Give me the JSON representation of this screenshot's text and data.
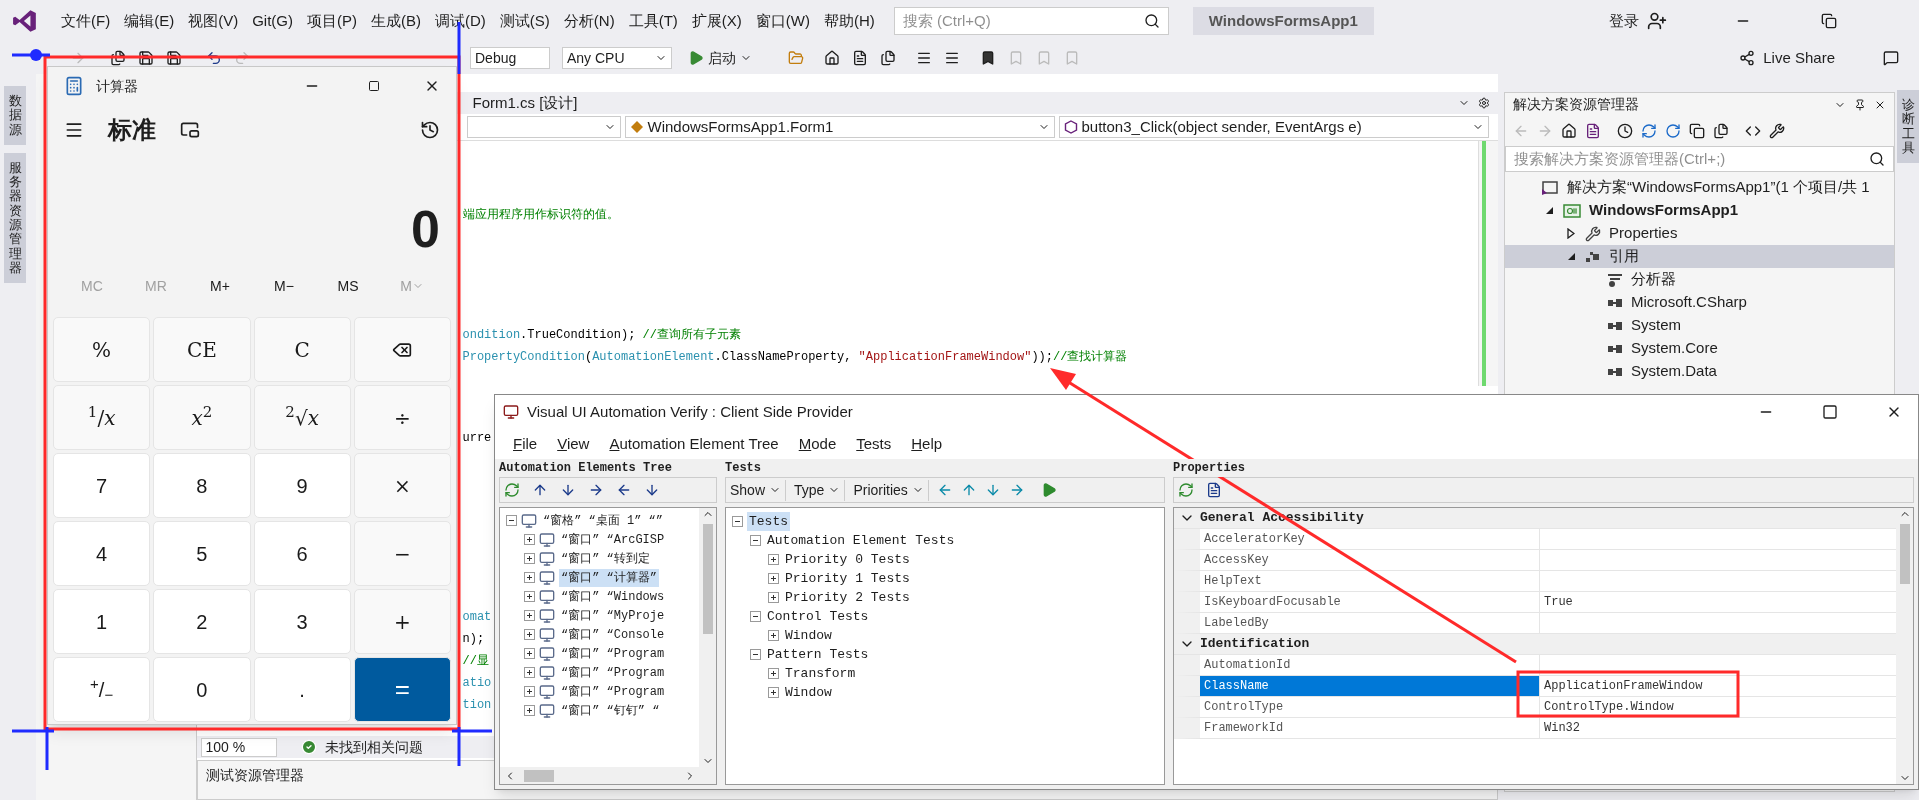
{
  "vs": {
    "menu": [
      "文件(F)",
      "编辑(E)",
      "视图(V)",
      "Git(G)",
      "项目(P)",
      "生成(B)",
      "调试(D)",
      "测试(S)",
      "分析(N)",
      "工具(T)",
      "扩展(X)",
      "窗口(W)",
      "帮助(H)"
    ],
    "search": {
      "placeholder": "搜索 (Ctrl+Q)"
    },
    "solution_name": "WindowsFormsApp1",
    "login": "登录",
    "toolbar": {
      "config": "Debug",
      "platform": "Any CPU",
      "start": "启动",
      "live_share": "Live Share"
    },
    "left_tabs": [
      "数据源",
      "服务器资源管理器"
    ],
    "right_tabs": [
      "诊断工具"
    ],
    "editor": {
      "tab": "Form1.cs [设计]",
      "nav": [
        "WindowsFormsApp1.Form1",
        "button3_Click(object sender, EventArgs e)"
      ],
      "blocks": [
        {
          "lines": [
            [
              {
                "kind": "comment",
                "text": "端应用程序用作标识符的值。"
              }
            ]
          ]
        },
        {
          "lines": [
            [
              {
                "kind": "type",
                "text": "ondition"
              },
              {
                "kind": "plain",
                "text": ".TrueCondition); "
              },
              {
                "kind": "comment",
                "text": "//查询所有子元素"
              }
            ],
            [
              {
                "kind": "type",
                "text": "PropertyCondition"
              },
              {
                "kind": "plain",
                "text": "("
              },
              {
                "kind": "type",
                "text": "AutomationElement"
              },
              {
                "kind": "plain",
                "text": ".ClassNameProperty, "
              },
              {
                "kind": "string",
                "text": "\"ApplicationFrameWindow\""
              },
              {
                "kind": "plain",
                "text": "));"
              },
              {
                "kind": "comment",
                "text": "//查找计算器"
              }
            ]
          ]
        },
        {
          "lines": [
            [
              {
                "kind": "plain",
                "text": "urre"
              }
            ]
          ]
        },
        {
          "lines": [
            [
              {
                "kind": "type",
                "text": "omat"
              }
            ],
            [
              {
                "kind": "plain",
                "text": "n);"
              }
            ],
            [
              {
                "kind": "comment",
                "text": "//显"
              }
            ],
            [
              {
                "kind": "type",
                "text": "atio"
              }
            ],
            [
              {
                "kind": "type",
                "text": "tion"
              }
            ]
          ]
        }
      ]
    },
    "status": {
      "zoom": "100 %",
      "issues": "未找到相关问题"
    },
    "bottom_panel": {
      "title": "测试资源管理器"
    }
  },
  "solution_explorer": {
    "title": "解决方案资源管理器",
    "search": {
      "placeholder": "搜索解决方案资源管理器(Ctrl+;)"
    },
    "tree": [
      {
        "kind": "solution",
        "label": "解决方案“WindowsFormsApp1”(1 个项目/共 1",
        "selected": false,
        "children": [
          {
            "kind": "csproject",
            "label": "WindowsFormsApp1",
            "expanded": true,
            "selected": false,
            "children": [
              {
                "kind": "properties",
                "label": "Properties",
                "expanded": false,
                "selected": false
              },
              {
                "kind": "references",
                "label": "引用",
                "expanded": true,
                "selected": true,
                "children": [
                  {
                    "kind": "analyzer",
                    "label": "分析器",
                    "selected": false
                  },
                  {
                    "kind": "assembly",
                    "label": "Microsoft.CSharp",
                    "selected": false
                  },
                  {
                    "kind": "assembly",
                    "label": "System",
                    "selected": false
                  },
                  {
                    "kind": "assembly",
                    "label": "System.Core",
                    "selected": false
                  },
                  {
                    "kind": "assembly",
                    "label": "System.Data",
                    "selected": false
                  }
                ]
              }
            ]
          }
        ]
      }
    ]
  },
  "calculator": {
    "title": "计算器",
    "mode": "标准",
    "display": "0",
    "memory": [
      {
        "label": "MC",
        "kind": "button",
        "disabled": true
      },
      {
        "label": "MR",
        "kind": "button",
        "disabled": true
      },
      {
        "label": "M+",
        "kind": "button",
        "disabled": false
      },
      {
        "label": "M−",
        "kind": "button",
        "disabled": false
      },
      {
        "label": "MS",
        "kind": "button",
        "disabled": false
      },
      {
        "label": "M",
        "kind": "menu",
        "disabled": true
      }
    ],
    "keys": [
      {
        "kind": "fn",
        "label": "%"
      },
      {
        "kind": "fn",
        "label": "CE"
      },
      {
        "kind": "fn",
        "label": "C"
      },
      {
        "kind": "backspace"
      },
      {
        "kind": "fn",
        "label": "$^{1}$/*x*"
      },
      {
        "kind": "fn",
        "label": "*x*$^{2}$"
      },
      {
        "kind": "fn",
        "label": "$^{2}$√*x*"
      },
      {
        "kind": "fn",
        "label": "÷"
      },
      {
        "kind": "digit",
        "label": "7"
      },
      {
        "kind": "digit",
        "label": "8"
      },
      {
        "kind": "digit",
        "label": "9"
      },
      {
        "kind": "fn",
        "label": "×"
      },
      {
        "kind": "digit",
        "label": "4"
      },
      {
        "kind": "digit",
        "label": "5"
      },
      {
        "kind": "digit",
        "label": "6"
      },
      {
        "kind": "fn",
        "label": "−"
      },
      {
        "kind": "digit",
        "label": "1"
      },
      {
        "kind": "digit",
        "label": "2"
      },
      {
        "kind": "digit",
        "label": "3"
      },
      {
        "kind": "fn",
        "label": "+"
      },
      {
        "kind": "digit",
        "label": "$^{+}$/$_{−}$"
      },
      {
        "kind": "digit",
        "label": "0"
      },
      {
        "kind": "digit",
        "label": "."
      },
      {
        "kind": "equals",
        "label": "="
      }
    ]
  },
  "uia": {
    "title": "Visual UI Automation Verify : Client Side Provider",
    "menu": [
      "File",
      "View",
      "Automation Element Tree",
      "Mode",
      "Tests",
      "Help"
    ],
    "tree_panel": {
      "title": "Automation Elements Tree",
      "tree": [
        {
          "label": "“窗格” “桌面 1” “”",
          "expanded": true,
          "selected": false,
          "children": [
            {
              "label": "“窗口” “ArcGISP",
              "expanded": false,
              "selected": false
            },
            {
              "label": "“窗口” “转到定",
              "expanded": false,
              "selected": false
            },
            {
              "label": "“窗口” “计算器”",
              "expanded": false,
              "selected": true
            },
            {
              "label": "“窗口” “Windows",
              "expanded": false,
              "selected": false
            },
            {
              "label": "“窗口” “MyProje",
              "expanded": false,
              "selected": false
            },
            {
              "label": "“窗口” “Console",
              "expanded": false,
              "selected": false
            },
            {
              "label": "“窗口” “Program",
              "expanded": false,
              "selected": false
            },
            {
              "label": "“窗口” “Program",
              "expanded": false,
              "selected": false
            },
            {
              "label": "“窗口” “Program",
              "expanded": false,
              "selected": false
            },
            {
              "label": "“窗口” “钉钉” “",
              "expanded": false,
              "selected": false
            }
          ]
        }
      ]
    },
    "tests_panel": {
      "title": "Tests",
      "toolbar": [
        "Show",
        "Type",
        "Priorities"
      ],
      "tree": [
        {
          "label": "Tests",
          "expanded": true,
          "selected": true,
          "children": [
            {
              "label": "Automation Element Tests",
              "expanded": true,
              "selected": false,
              "children": [
                {
                  "label": "Priority 0 Tests",
                  "expanded": false,
                  "selected": false
                },
                {
                  "label": "Priority 1 Tests",
                  "expanded": false,
                  "selected": false
                },
                {
                  "label": "Priority 2 Tests",
                  "expanded": false,
                  "selected": false
                }
              ]
            },
            {
              "label": "Control Tests",
              "expanded": true,
              "selected": false,
              "children": [
                {
                  "label": "Window",
                  "expanded": false,
                  "selected": false
                }
              ]
            },
            {
              "label": "Pattern Tests",
              "expanded": true,
              "selected": false,
              "children": [
                {
                  "label": "Transform",
                  "expanded": false,
                  "selected": false
                },
                {
                  "label": "Window",
                  "expanded": false,
                  "selected": false
                }
              ]
            }
          ]
        }
      ]
    },
    "properties_panel": {
      "title": "Properties",
      "groups": [
        {
          "name": "General Accessibility",
          "expanded": true,
          "rows": [
            {
              "name": "AcceleratorKey",
              "selected": false
            },
            {
              "name": "AccessKey",
              "selected": false
            },
            {
              "name": "HelpText",
              "selected": false
            },
            {
              "name": "IsKeyboardFocusable",
              "value": "True",
              "selected": false
            },
            {
              "name": "LabeledBy",
              "selected": false
            }
          ]
        },
        {
          "name": "Identification",
          "expanded": true,
          "rows": [
            {
              "name": "AutomationId",
              "selected": false
            },
            {
              "name": "ClassName",
              "value": "ApplicationFrameWindow",
              "selected": true
            },
            {
              "name": "ControlType",
              "value": "ControlType.Window",
              "selected": false
            },
            {
              "name": "FrameworkId",
              "value": "Win32",
              "selected": false
            }
          ]
        }
      ]
    }
  }
}
